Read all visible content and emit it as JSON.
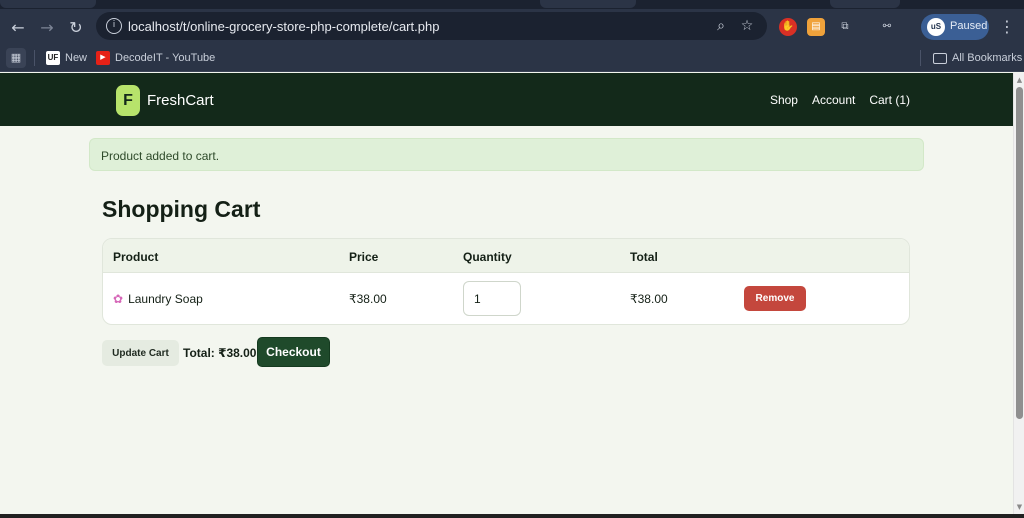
{
  "browser": {
    "url": "localhost/t/online-grocery-store-php-complete/cart.php",
    "nav_icons": {
      "back": "arrow-left-icon",
      "forward": "arrow-right-icon",
      "reload": "reload-icon",
      "info": "site-info-icon"
    },
    "omnibox_icons": {
      "zoom": "zoom-icon",
      "star": "bookmark-star-icon"
    },
    "extensions": [
      {
        "name": "extension-red-icon",
        "color": "#d93025"
      },
      {
        "name": "extension-orange-icon",
        "color": "#f0a23b"
      },
      {
        "name": "extensions-puzzle-icon",
        "color": "#c9cfda"
      },
      {
        "name": "incognito-icon",
        "color": "#c9cfda"
      }
    ],
    "profile": {
      "avatar_text": "uS",
      "label": "Paused"
    },
    "bookmarks": {
      "items": [
        {
          "label": "New",
          "icon": "uf-favicon"
        },
        {
          "label": "DecodeIT - YouTube",
          "icon": "youtube-favicon"
        }
      ],
      "all_bookmarks": "All Bookmarks"
    }
  },
  "site": {
    "logo_letter": "F",
    "brand": "FreshCart",
    "nav": [
      "Shop",
      "Account",
      "Cart (1)"
    ],
    "colors": {
      "header": "#13291a",
      "logo": "#b7e36b",
      "remove": "#c4473d",
      "checkout": "#1f4a2b"
    }
  },
  "flash": {
    "message": "Product added to cart."
  },
  "cart": {
    "title": "Shopping Cart",
    "columns": [
      "Product",
      "Price",
      "Quantity",
      "Total"
    ],
    "rows": [
      {
        "icon": "soap-icon",
        "product": "Laundry Soap",
        "price": "₹38.00",
        "quantity": "1",
        "total": "₹38.00",
        "remove_label": "Remove"
      }
    ],
    "update_label": "Update Cart",
    "grand_total": "Total: ₹38.00",
    "checkout_label": "Checkout"
  }
}
